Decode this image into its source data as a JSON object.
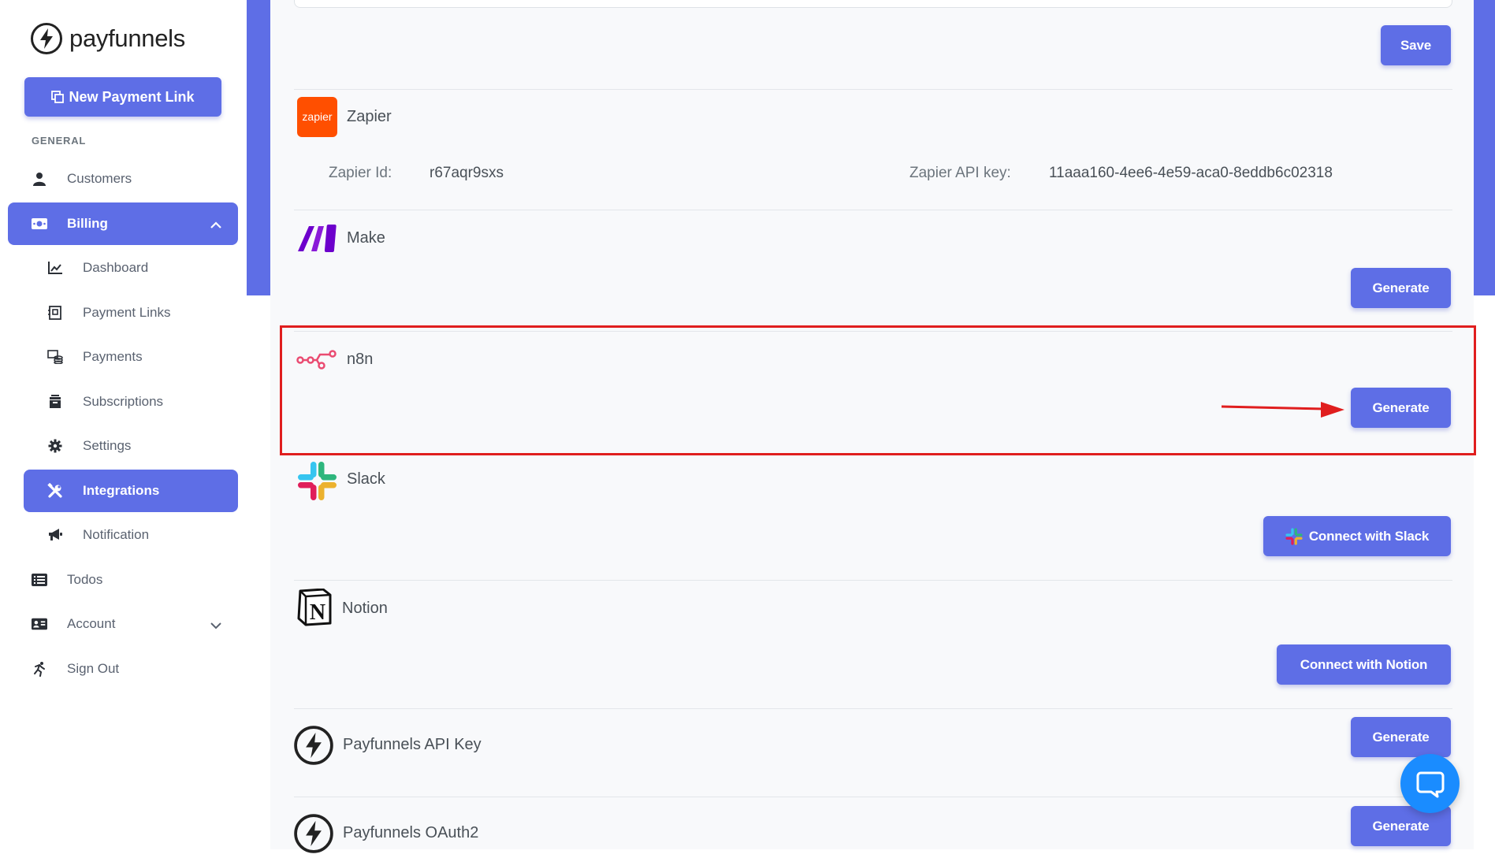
{
  "brand": {
    "name": "payfunnels",
    "accent": "#5e6ee6"
  },
  "sidebar": {
    "new_link_label": "New Payment Link",
    "section_general": "GENERAL",
    "items": {
      "customers": "Customers",
      "billing": "Billing",
      "dashboard": "Dashboard",
      "payment_links": "Payment Links",
      "payments": "Payments",
      "subscriptions": "Subscriptions",
      "settings": "Settings",
      "integrations": "Integrations",
      "notification": "Notification",
      "todos": "Todos",
      "account": "Account",
      "sign_out": "Sign Out"
    }
  },
  "main": {
    "save_label": "Save",
    "zapier": {
      "title": "Zapier",
      "logo_text": "zapier",
      "id_label": "Zapier Id:",
      "id_value": "r67aqr9sxs",
      "api_label": "Zapier API key:",
      "api_value": "11aaa160-4ee6-4e59-aca0-8eddb6c02318"
    },
    "make": {
      "title": "Make",
      "button": "Generate"
    },
    "n8n": {
      "title": "n8n",
      "button": "Generate"
    },
    "slack": {
      "title": "Slack",
      "button": "Connect with Slack"
    },
    "notion": {
      "title": "Notion",
      "button": "Connect with Notion"
    },
    "api_key": {
      "title": "Payfunnels API Key",
      "button": "Generate"
    },
    "oauth": {
      "title": "Payfunnels OAuth2",
      "button": "Generate"
    }
  },
  "annotation_color": "#e01e1e"
}
